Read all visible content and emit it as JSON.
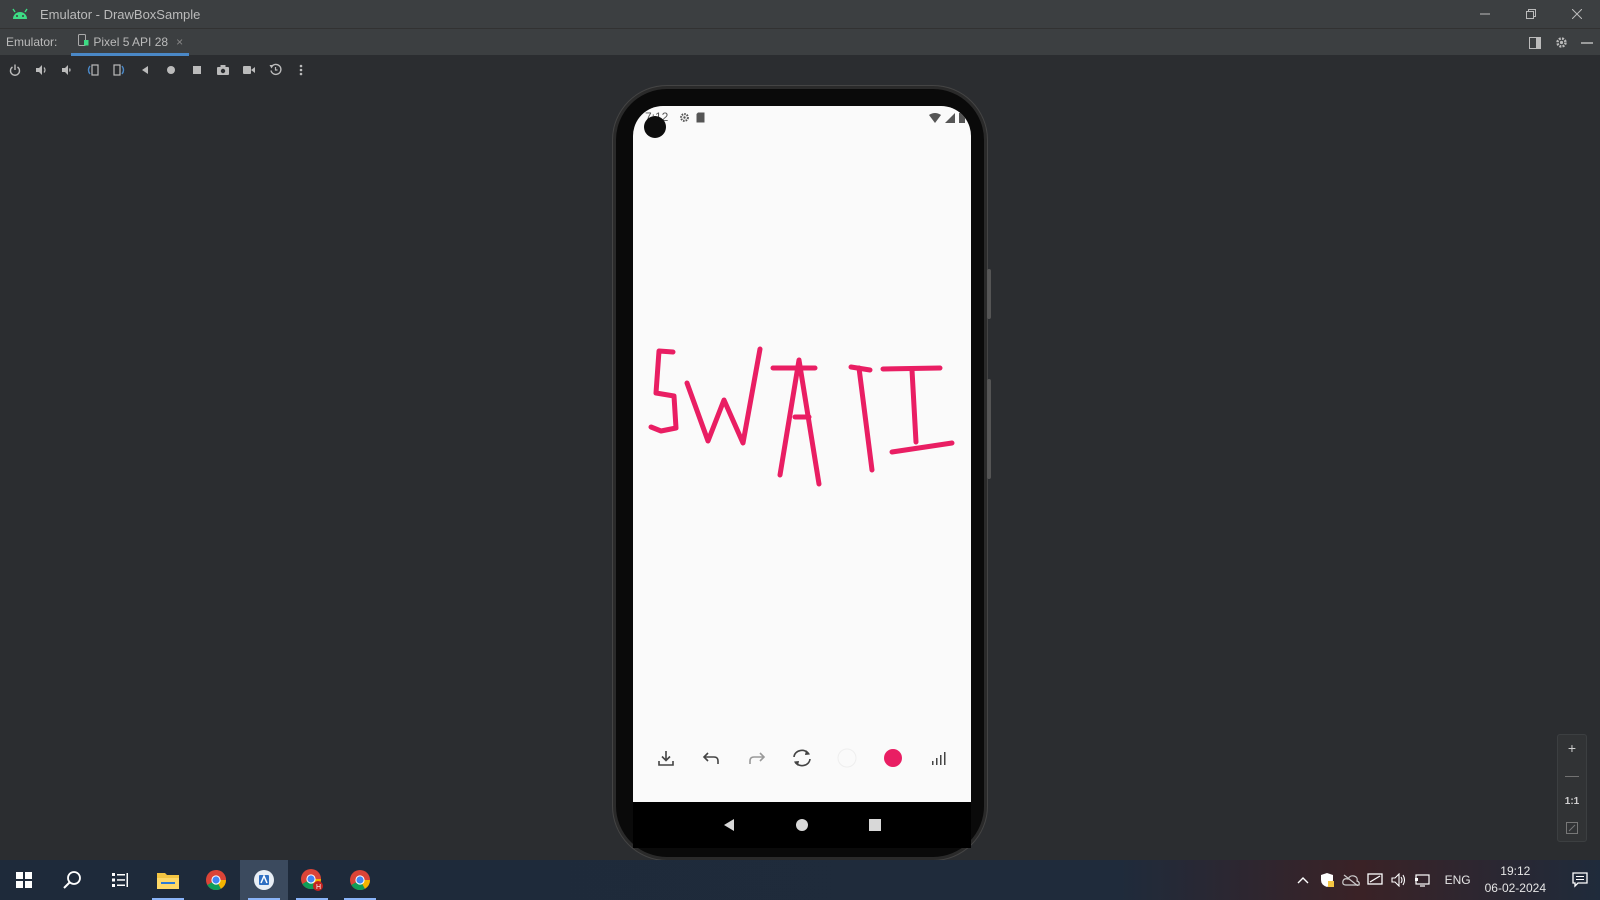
{
  "window": {
    "title": "Emulator - DrawBoxSample"
  },
  "tabbar": {
    "label": "Emulator:",
    "tab_label": "Pixel 5 API 28",
    "tab_close": "×"
  },
  "toolbar": {
    "buttons": [
      "power-icon",
      "volume-up-icon",
      "volume-down-icon",
      "rotate-left-icon",
      "rotate-right-icon",
      "back-icon",
      "home-icon",
      "overview-icon",
      "screenshot-icon",
      "screen-record-icon",
      "snapshot-icon",
      "more-icon"
    ]
  },
  "phone": {
    "status_time": "7:12",
    "drawing_text": "SWATI",
    "drawing_color": "#e91e63",
    "app_toolbar": [
      "download-icon",
      "undo-icon",
      "redo-icon",
      "reset-icon",
      "background-color-icon",
      "stroke-color-icon",
      "stroke-width-icon"
    ]
  },
  "zoom": {
    "zoom_in": "+",
    "zoom_out": "—",
    "actual_size": "1:1"
  },
  "taskbar": {
    "language": "ENG",
    "time": "19:12",
    "date": "06-02-2024"
  },
  "colors": {
    "accent": "#4a88c7",
    "android_green": "#3ddc84",
    "ink": "#e91e63"
  }
}
